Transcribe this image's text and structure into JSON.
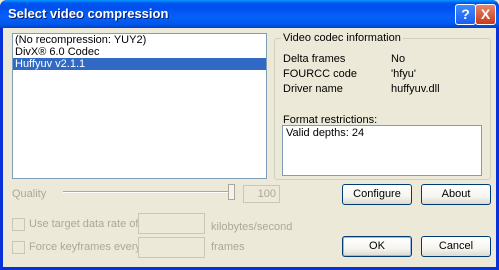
{
  "window": {
    "title": "Select video compression"
  },
  "title_buttons": {
    "help": "?",
    "close": "X"
  },
  "codec_list": {
    "items": [
      {
        "label": "(No recompression: YUY2)",
        "selected": false
      },
      {
        "label": "DivX® 6.0 Codec",
        "selected": false
      },
      {
        "label": "Huffyuv v2.1.1",
        "selected": true
      }
    ]
  },
  "codec_info": {
    "group_title": "Video codec information",
    "rows": [
      {
        "label": "Delta frames",
        "value": "No"
      },
      {
        "label": "FOURCC code",
        "value": "'hfyu'"
      },
      {
        "label": "Driver name",
        "value": "huffyuv.dll"
      }
    ],
    "restrictions_label": "Format restrictions:",
    "restrictions_text": "Valid depths: 24"
  },
  "quality": {
    "label": "Quality",
    "value": "100",
    "level_percent": 100
  },
  "data_rate": {
    "label": "Use target data rate of",
    "unit": "kilobytes/second",
    "value": ""
  },
  "keyframes": {
    "label": "Force keyframes every",
    "unit": "frames",
    "value": ""
  },
  "buttons": {
    "configure": "Configure",
    "about": "About",
    "ok": "OK",
    "cancel": "Cancel"
  }
}
